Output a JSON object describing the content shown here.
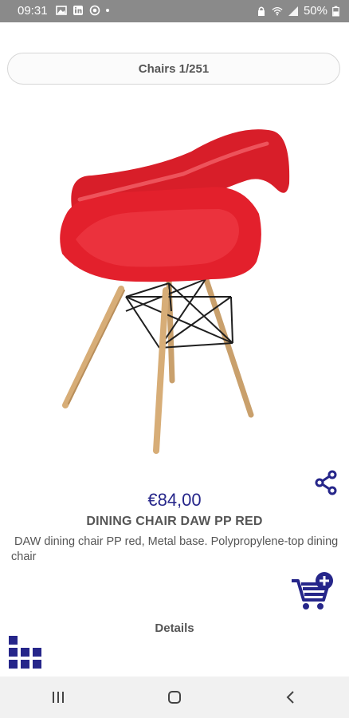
{
  "status_bar": {
    "time": "09:31",
    "battery": "50%",
    "icons": [
      "image-icon",
      "linkedin-icon",
      "record-icon",
      "dot-icon",
      "lock-icon",
      "wifi-icon",
      "signal-icon",
      "battery-icon"
    ]
  },
  "category": {
    "label": "Chairs 1/251"
  },
  "product": {
    "image_alt": "red plastic armchair with wooden legs",
    "price": "€84,00",
    "name": "DINING CHAIR DAW PP RED",
    "description": "DAW dining chair PP red, Metal base. Polypropylene-top dining chair"
  },
  "actions": {
    "share_icon": "share-icon",
    "add_to_cart_icon": "add-to-cart-icon"
  },
  "details": {
    "label": "Details"
  },
  "navigation": {
    "items": [
      "recent-apps-icon",
      "home-icon",
      "back-icon"
    ]
  },
  "colors": {
    "accent": "#26268a",
    "chair_red": "#e3202c",
    "status_bar": "#8a8a8a"
  }
}
